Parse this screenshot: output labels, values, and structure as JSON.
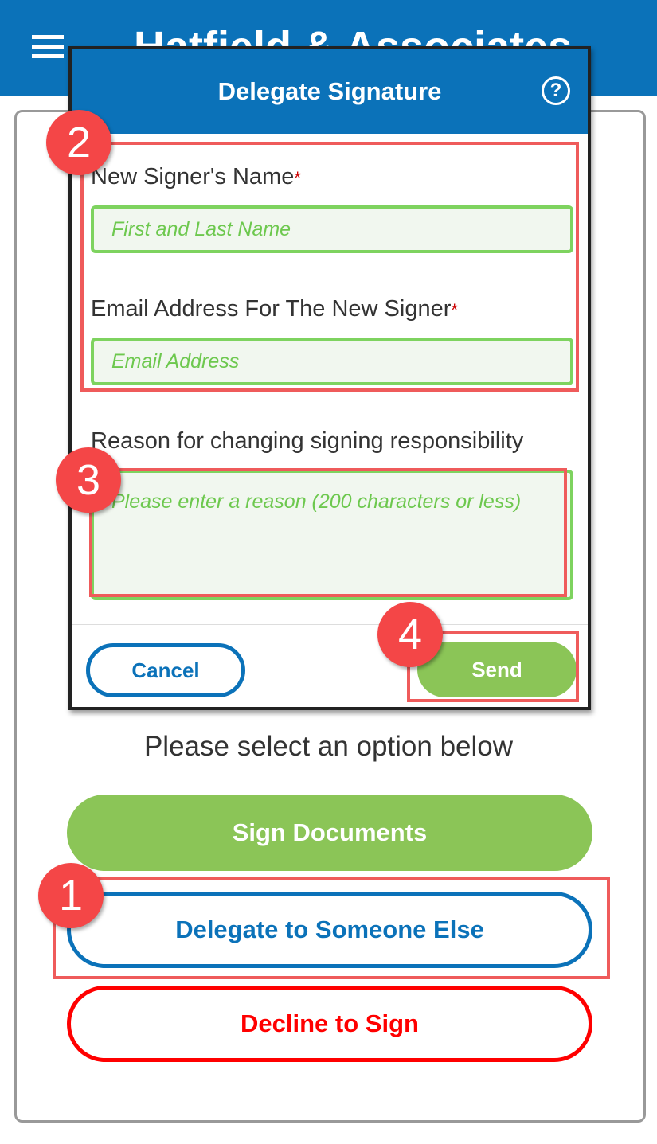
{
  "app": {
    "title": "Hatfield & Associates",
    "menu_icon": "hamburger-icon"
  },
  "main": {
    "prompt": "Please select an option below",
    "sign_label": "Sign Documents",
    "delegate_label": "Delegate to Someone Else",
    "decline_label": "Decline to Sign"
  },
  "modal": {
    "title": "Delegate Signature",
    "help_icon": "?",
    "name_label": "New Signer's Name",
    "name_placeholder": "First and Last Name",
    "email_label": "Email Address For The New Signer",
    "email_placeholder": "Email Address",
    "reason_label": "Reason for changing signing responsibility",
    "reason_placeholder": "Please enter a reason (200 characters or less)",
    "required_marker": "*",
    "cancel_label": "Cancel",
    "send_label": "Send"
  },
  "annotations": [
    "1",
    "2",
    "3",
    "4"
  ],
  "colors": {
    "brand": "#0b72b9",
    "green": "#8bc557",
    "decline": "#ff0000",
    "highlight": "#ef5b5b",
    "badge": "#f44647"
  }
}
